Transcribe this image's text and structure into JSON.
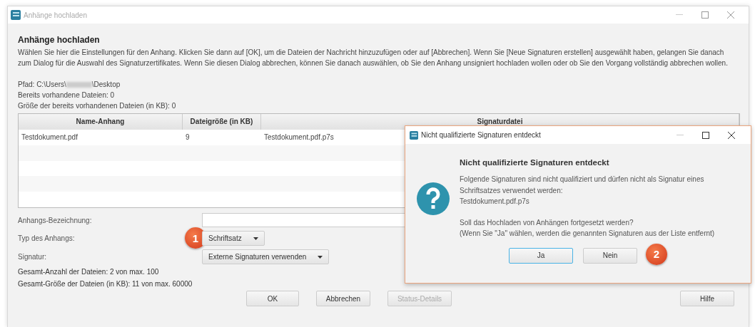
{
  "window": {
    "title": "Anhänge hochladen"
  },
  "heading": "Anhänge hochladen",
  "description": "Wählen Sie hier die Einstellungen für den Anhang. Klicken Sie dann auf [OK], um die Dateien der Nachricht hinzuzufügen oder auf [Abbrechen]. Wenn Sie [Neue Signaturen erstellen] ausgewählt haben, gelangen Sie danach zum Dialog für die Auswahl des Signaturzertifikates. Wenn Sie diesen Dialog abbrechen, können Sie danach auswählen, ob Sie den Anhang unsigniert hochladen wollen oder ob Sie den Vorgang vollständig abbrechen wollen.",
  "path": {
    "prefix": "Pfad: C:\\Users\\",
    "suffix": "\\Desktop"
  },
  "info_lines": [
    "Bereits vorhandene Dateien: 0",
    "Größe der bereits vorhandenen Dateien (in KB): 0"
  ],
  "table": {
    "columns": [
      "Name-Anhang",
      "Dateigröße (in KB)",
      "Signaturdatei"
    ],
    "rows": [
      [
        "Testdokument.pdf",
        "9",
        "Testdokument.pdf.p7s"
      ]
    ]
  },
  "form": [
    {
      "kind": "input",
      "label": "Anhangs-Bezeichnung:"
    },
    {
      "kind": "select",
      "label": "Typ des Anhangs:",
      "value": "Schriftsatz",
      "badge": "1"
    },
    {
      "kind": "select",
      "label": "Signatur:",
      "value": "Externe Signaturen verwenden"
    }
  ],
  "totals": [
    "Gesamt-Anzahl der Dateien: 2 von max. 100",
    "Gesamt-Größe der Dateien (in KB): 11 von max. 60000"
  ],
  "buttons": [
    {
      "label": "OK",
      "disabled": false
    },
    {
      "label": "Abbrechen",
      "disabled": false
    },
    {
      "label": "Status-Details",
      "disabled": true
    }
  ],
  "help_button": {
    "label": "Hilfe",
    "disabled": false
  },
  "dialog": {
    "title": "Nicht qualifizierte Signaturen entdeckt",
    "heading": "Nicht qualifizierte Signaturen entdeckt",
    "lines": [
      "Folgende Signaturen sind nicht qualifiziert und dürfen nicht als Signatur eines Schriftsatzes verwendet werden:",
      "Testdokument.pdf.p7s"
    ],
    "question": [
      "Soll das Hochladen von Anhängen fortgesetzt werden?",
      "(Wenn Sie \"Ja\" wählen, werden die genannten Signaturen aus der Liste entfernt)"
    ],
    "buttons": [
      {
        "label": "Ja",
        "focused": true
      },
      {
        "label": "Nein",
        "focused": false,
        "badge": "2"
      }
    ]
  }
}
